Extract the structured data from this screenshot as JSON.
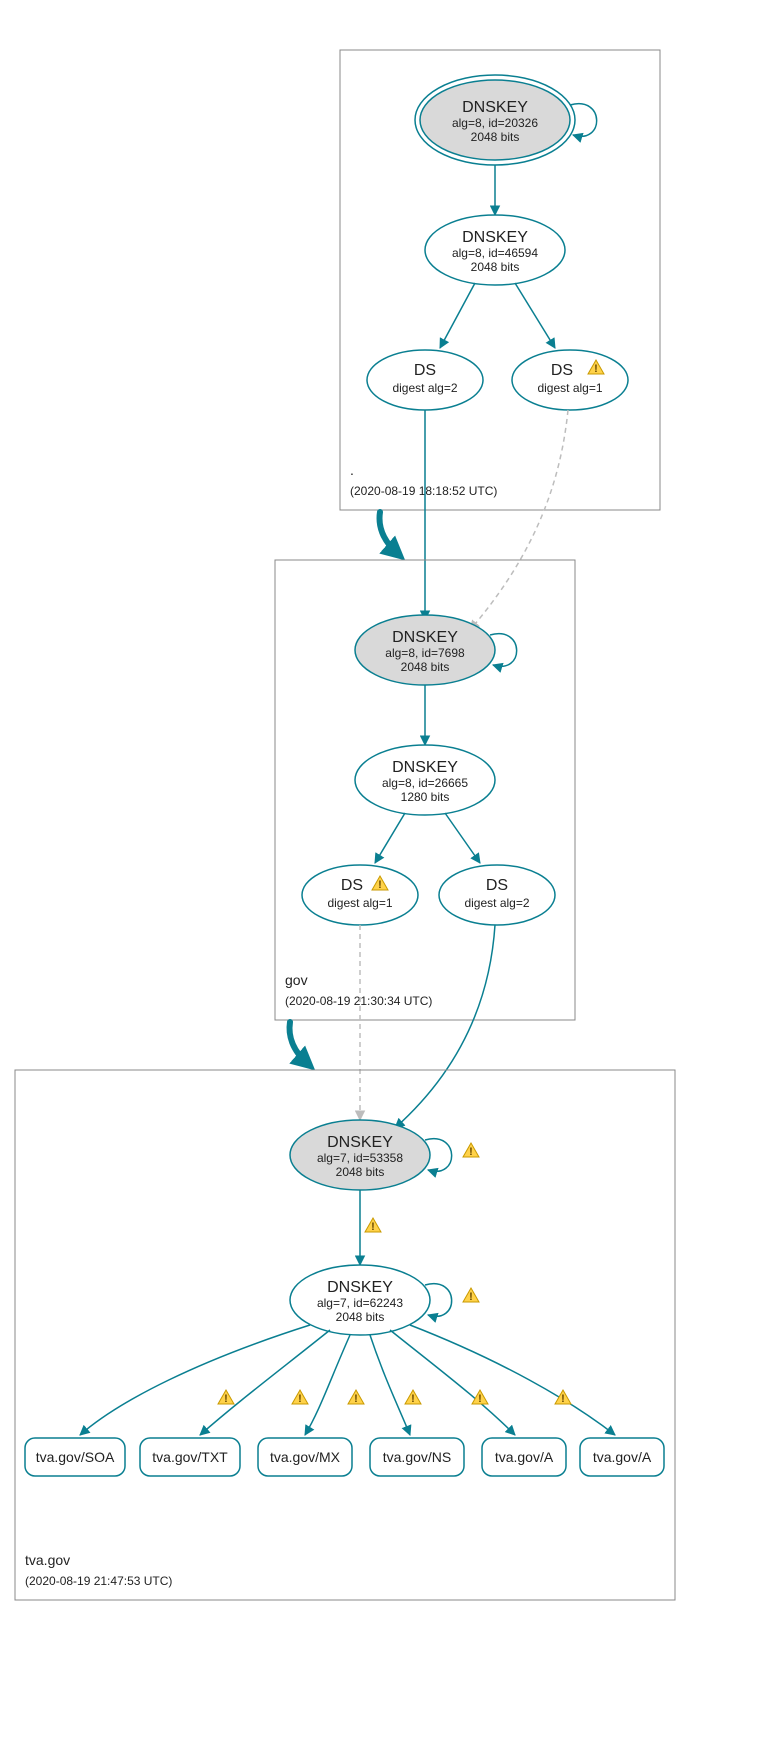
{
  "colors": {
    "teal": "#0a7f91",
    "grey": "#bdbdbd",
    "warn": "#ffd24a"
  },
  "zones": [
    {
      "name": ".",
      "timestamp": "(2020-08-19 18:18:52 UTC)",
      "nodes": {
        "ksk": {
          "title": "DNSKEY",
          "line2": "alg=8, id=20326",
          "line3": "2048 bits"
        },
        "zsk": {
          "title": "DNSKEY",
          "line2": "alg=8, id=46594",
          "line3": "2048 bits"
        },
        "ds1": {
          "title": "DS",
          "line2": "digest alg=2",
          "warn": false
        },
        "ds2": {
          "title": "DS",
          "line2": "digest alg=1",
          "warn": true
        }
      }
    },
    {
      "name": "gov",
      "timestamp": "(2020-08-19 21:30:34 UTC)",
      "nodes": {
        "ksk": {
          "title": "DNSKEY",
          "line2": "alg=8, id=7698",
          "line3": "2048 bits"
        },
        "zsk": {
          "title": "DNSKEY",
          "line2": "alg=8, id=26665",
          "line3": "1280 bits"
        },
        "ds1": {
          "title": "DS",
          "line2": "digest alg=1",
          "warn": true
        },
        "ds2": {
          "title": "DS",
          "line2": "digest alg=2",
          "warn": false
        }
      }
    },
    {
      "name": "tva.gov",
      "timestamp": "(2020-08-19 21:47:53 UTC)",
      "nodes": {
        "ksk": {
          "title": "DNSKEY",
          "line2": "alg=7, id=53358",
          "line3": "2048 bits",
          "self_warn": true
        },
        "zsk": {
          "title": "DNSKEY",
          "line2": "alg=7, id=62243",
          "line3": "2048 bits",
          "self_warn": true
        }
      },
      "leaves": [
        {
          "label": "tva.gov/SOA",
          "warn": false
        },
        {
          "label": "tva.gov/TXT",
          "warn": true
        },
        {
          "label": "tva.gov/MX",
          "warn": true
        },
        {
          "label": "tva.gov/NS",
          "warn": true
        },
        {
          "label": "tva.gov/A",
          "warn": true
        },
        {
          "label": "tva.gov/A",
          "warn": true
        }
      ],
      "arrow_warn": true
    }
  ]
}
